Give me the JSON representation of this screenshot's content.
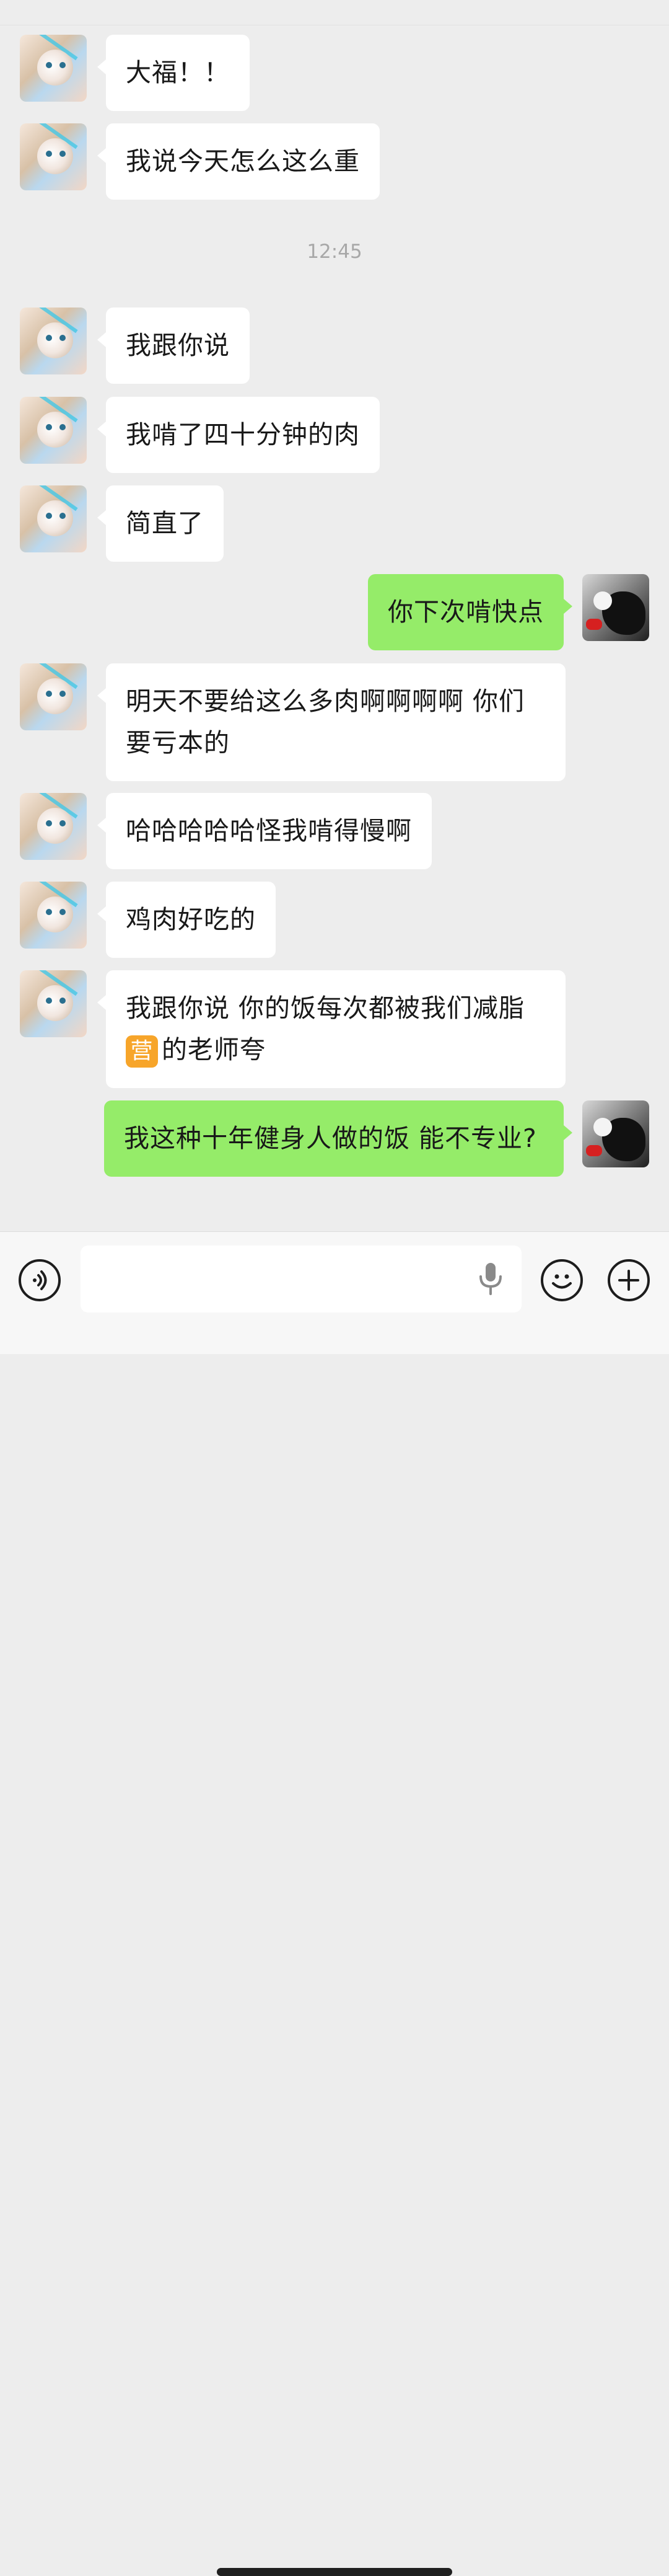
{
  "chat": {
    "messages": [
      {
        "side": "in",
        "text": "大福！！"
      },
      {
        "side": "in",
        "text": "我说今天怎么这么重"
      },
      {
        "side": "in",
        "text": "我跟你说"
      },
      {
        "side": "in",
        "text": "我啃了四十分钟的肉"
      },
      {
        "side": "in",
        "text": "简直了"
      },
      {
        "side": "out",
        "text": "你下次啃快点"
      },
      {
        "side": "in",
        "text": "明天不要给这么多肉啊啊啊啊 你们要亏本的"
      },
      {
        "side": "in",
        "text": "哈哈哈哈哈怪我啃得慢啊"
      },
      {
        "side": "in",
        "text": "鸡肉好吃的"
      },
      {
        "side": "in",
        "text_before": "我跟你说 你的饭每次都被我们减脂",
        "badge": "营",
        "text_after": "的老师夸"
      },
      {
        "side": "out",
        "text": "我这种十年健身人做的饭 能不专业?"
      }
    ],
    "time_divider": "12:45"
  },
  "input_bar": {
    "value": "",
    "placeholder": ""
  },
  "colors": {
    "background": "#ededed",
    "incoming_bubble": "#ffffff",
    "outgoing_bubble": "#95ec69",
    "badge": "#f7a52a"
  },
  "icons": {
    "voice": "voice-icon",
    "mic": "microphone-icon",
    "emoji": "emoji-icon",
    "plus": "plus-icon"
  }
}
